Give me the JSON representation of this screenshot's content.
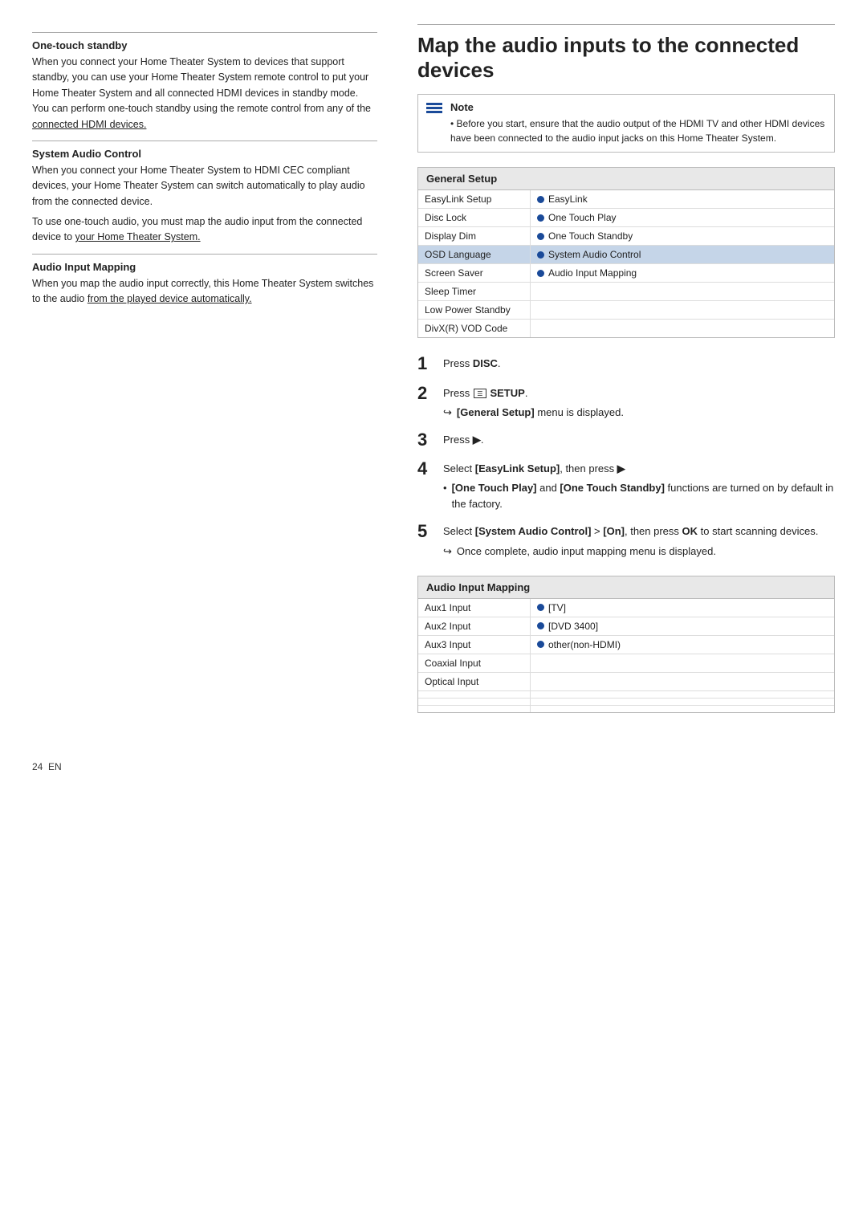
{
  "left_col": {
    "sections": [
      {
        "heading": "One-touch standby",
        "body": "When you connect your Home Theater System to devices that support standby, you can use your Home Theater System remote control to put your Home Theater System and all connected HDMI devices in standby mode. You can perform one-touch standby using the remote control from any of the connected HDMI devices.",
        "underline_text": "connected HDMI devices."
      },
      {
        "heading": "System Audio Control",
        "body1": "When you connect your Home Theater System to HDMI CEC compliant devices, your Home Theater System can switch automatically to play audio from the connected device.",
        "body2": "To use one-touch audio, you must map the audio input from the connected device to your Home Theater System.",
        "underline_text": "your Home Theater System."
      },
      {
        "heading": "Audio Input Mapping",
        "body": "When you map the audio input correctly, this Home Theater System switches to the audio from the played device automatically.",
        "underline_text": "from the played device automatically."
      }
    ]
  },
  "right_col": {
    "main_heading": "Map the audio inputs to the connected devices",
    "note": {
      "label": "Note",
      "text": "Before you start, ensure that the audio output of the HDMI TV and other HDMI devices have been connected to the audio input jacks on this Home Theater System."
    },
    "general_setup": {
      "title": "General Setup",
      "rows": [
        {
          "left": "EasyLink Setup",
          "right": "EasyLink",
          "highlighted": false,
          "dot": true
        },
        {
          "left": "Disc Lock",
          "right": "One Touch Play",
          "highlighted": false,
          "dot": true
        },
        {
          "left": "Display Dim",
          "right": "One Touch Standby",
          "highlighted": false,
          "dot": true
        },
        {
          "left": "OSD Language",
          "right": "System Audio Control",
          "highlighted": true,
          "dot": true
        },
        {
          "left": "Screen Saver",
          "right": "Audio Input Mapping",
          "highlighted": false,
          "dot": true
        },
        {
          "left": "Sleep Timer",
          "right": "",
          "highlighted": false,
          "dot": false
        },
        {
          "left": "Low Power Standby",
          "right": "",
          "highlighted": false,
          "dot": false
        },
        {
          "left": "DivX(R) VOD Code",
          "right": "",
          "highlighted": false,
          "dot": false
        }
      ]
    },
    "steps": [
      {
        "number": "1",
        "text": "Press ",
        "bold": "DISC",
        "suffix": ".",
        "sub_arrow": null,
        "sub_bullets": null
      },
      {
        "number": "2",
        "text_parts": [
          "Press ",
          "SETUP",
          "."
        ],
        "setup_icon": true,
        "sub_arrow": "[General Setup] menu is displayed.",
        "sub_bullets": null
      },
      {
        "number": "3",
        "text_parts": [
          "Press ",
          "▶",
          "."
        ],
        "sub_arrow": null,
        "sub_bullets": null
      },
      {
        "number": "4",
        "text_parts": [
          "Select ",
          "[EasyLink Setup]",
          ", then press ▶"
        ],
        "sub_arrow": null,
        "sub_bullets": [
          "[One Touch Play] and [One Touch Standby] functions are turned on by default in the factory."
        ]
      },
      {
        "number": "5",
        "text_parts": [
          "Select ",
          "[System Audio Control]",
          " > ",
          "[On]",
          ", then press ",
          "OK",
          " to start scanning devices."
        ],
        "sub_arrow": "Once complete, audio input mapping menu is displayed.",
        "sub_bullets": null
      }
    ],
    "audio_input_mapping": {
      "title": "Audio Input Mapping",
      "rows": [
        {
          "left": "Aux1 Input",
          "right": "[TV]",
          "dot": true
        },
        {
          "left": "Aux2 Input",
          "right": "[DVD 3400]",
          "dot": true
        },
        {
          "left": "Aux3 Input",
          "right": "other(non-HDMI)",
          "dot": true
        },
        {
          "left": "Coaxial Input",
          "right": "",
          "dot": false
        },
        {
          "left": "Optical Input",
          "right": "",
          "dot": false
        },
        {
          "left": "",
          "right": "",
          "dot": false
        },
        {
          "left": "",
          "right": "",
          "dot": false
        },
        {
          "left": "",
          "right": "",
          "dot": false
        }
      ]
    }
  },
  "footer": {
    "page_number": "24",
    "lang": "EN"
  }
}
